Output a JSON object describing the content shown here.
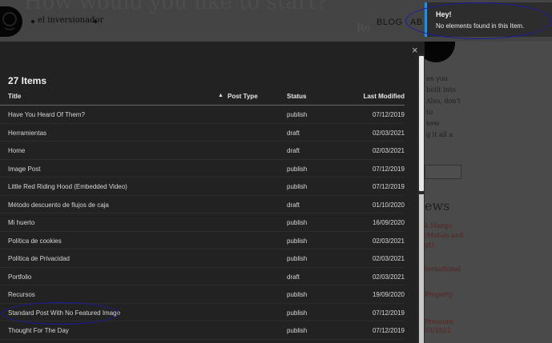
{
  "site": {
    "bigtitle": "How would you like to start?",
    "name": "el inversionador",
    "nav": [
      "BLOG",
      "AB"
    ],
    "faded_button": "Re"
  },
  "right_column": {
    "texts": [
      "en you",
      "built into",
      "Also, don't",
      "to",
      "new",
      "g it all a"
    ],
    "heading": "ews",
    "links": [
      "k Margo",
      "(Metals and",
      "gt)",
      "ternational",
      "Property",
      "Pressure",
      "03/2021"
    ]
  },
  "toast": {
    "title": "Hey!",
    "message": "No elements found in this Item."
  },
  "modal": {
    "close_label": "×",
    "item_count": "27 Items",
    "columns": {
      "title": "Title",
      "post_type": "Post Type",
      "status": "Status",
      "last_modified": "Last Modified"
    },
    "sort_icon": "sort-caret-up-icon",
    "rows": [
      {
        "title": "Have You Heard Of Them?",
        "status": "publish",
        "date": "07/12/2019"
      },
      {
        "title": "Herramientas",
        "status": "draft",
        "date": "02/03/2021"
      },
      {
        "title": "Home",
        "status": "draft",
        "date": "02/03/2021"
      },
      {
        "title": "Image Post",
        "status": "publish",
        "date": "07/12/2019"
      },
      {
        "title": "Little Red Riding Hood (Embedded Video)",
        "status": "publish",
        "date": "07/12/2019"
      },
      {
        "title": "Método descuento de flujos de caja",
        "status": "draft",
        "date": "01/10/2020"
      },
      {
        "title": "Mi huerto",
        "status": "publish",
        "date": "16/09/2020"
      },
      {
        "title": "Política de cookies",
        "status": "publish",
        "date": "02/03/2021"
      },
      {
        "title": "Política de Privacidad",
        "status": "publish",
        "date": "02/03/2021"
      },
      {
        "title": "Portfolio",
        "status": "draft",
        "date": "02/03/2021"
      },
      {
        "title": "Recursos",
        "status": "publish",
        "date": "19/09/2020"
      },
      {
        "title": "Standard Post With No Featured Image",
        "status": "publish",
        "date": "07/12/2019"
      },
      {
        "title": "Thought For The Day",
        "status": "publish",
        "date": "07/12/2019"
      }
    ]
  },
  "colors": {
    "toast_accent": "#2e8bd6",
    "annotation": "#1a1aa8"
  }
}
